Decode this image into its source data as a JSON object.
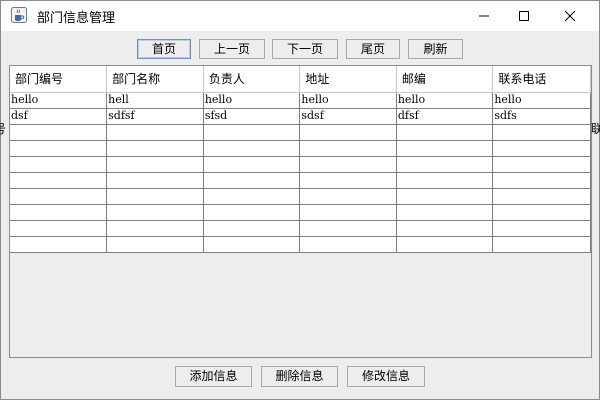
{
  "window": {
    "title": "部门信息管理",
    "icon": "java-cup-icon"
  },
  "toolbar": {
    "buttons": [
      "首页",
      "上一页",
      "下一页",
      "尾页",
      "刷新"
    ]
  },
  "table": {
    "columns": [
      "部门编号",
      "部门名称",
      "负责人",
      "地址",
      "邮编",
      "联系电话"
    ],
    "rows": [
      [
        "hello",
        "hell",
        "hello",
        "hello",
        "hello",
        "hello"
      ],
      [
        "dsf",
        "sdfsf",
        "sfsd",
        "sdsf",
        "dfsf",
        "sdfs"
      ],
      [
        "",
        "",
        "",
        "",
        "",
        ""
      ],
      [
        "",
        "",
        "",
        "",
        "",
        ""
      ],
      [
        "",
        "",
        "",
        "",
        "",
        ""
      ],
      [
        "",
        "",
        "",
        "",
        "",
        ""
      ],
      [
        "",
        "",
        "",
        "",
        "",
        ""
      ],
      [
        "",
        "",
        "",
        "",
        "",
        ""
      ],
      [
        "",
        "",
        "",
        "",
        "",
        ""
      ],
      [
        "",
        "",
        "",
        "",
        "",
        ""
      ]
    ]
  },
  "actions": {
    "add": "添加信息",
    "delete": "删除信息",
    "modify": "修改信息"
  },
  "background": {
    "left_fragment": "号",
    "right_fragment": "联"
  }
}
